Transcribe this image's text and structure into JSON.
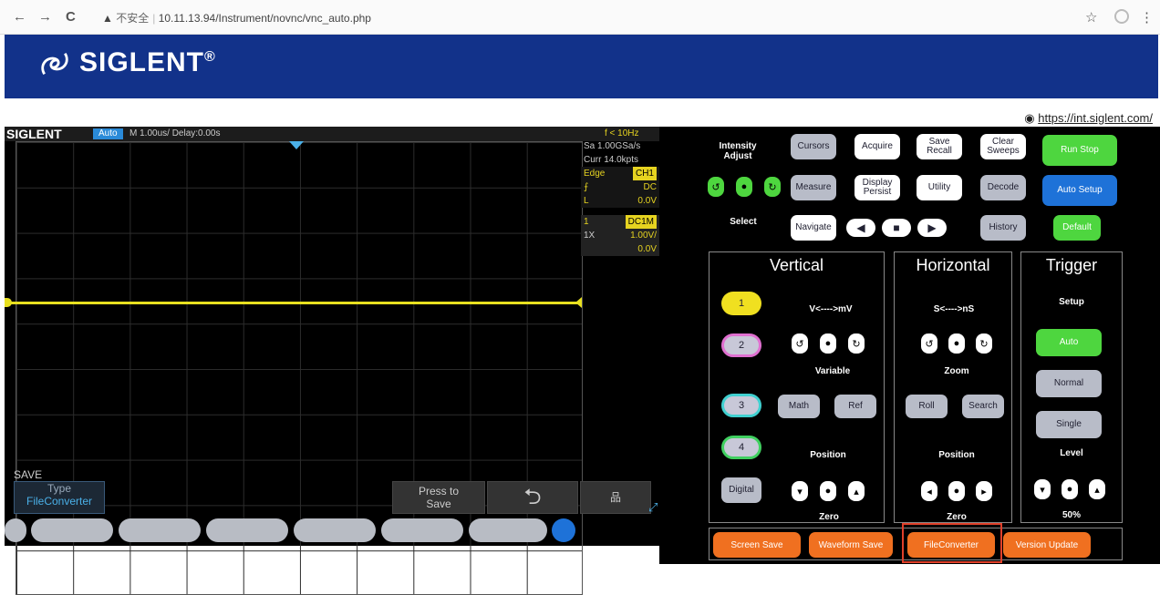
{
  "browser": {
    "security": "不安全",
    "url": "10.11.13.94/Instrument/novnc/vnc_auto.php",
    "back": "←",
    "forward": "→",
    "reload": "C",
    "star": "☆",
    "menu": "⋮"
  },
  "header": {
    "brand": "SIGLENT",
    "reg": "®"
  },
  "link": {
    "text": "https://int.siglent.com/"
  },
  "scope": {
    "brand": "SIGLENT",
    "mode": "Auto",
    "timebase": "M 1.00us/  Delay:0.00s",
    "freq": "f < 10Hz",
    "sa": "Sa 1.00GSa/s",
    "curr": "Curr 14.0kpts",
    "edge": "Edge",
    "edge_ch": "CH1",
    "slope": "⨍",
    "coupling": "DC",
    "level_l": "L",
    "level_v": "0.0V",
    "ch_num": "1",
    "ch_cpl": "DC1M",
    "probe": "1X",
    "vdiv": "1.00V/",
    "offset": "0.0V",
    "save_title": "SAVE",
    "type_label": "Type",
    "type_value": "FileConverter",
    "press_save_1": "Press to",
    "press_save_2": "Save",
    "return_icon": "⮌",
    "net_icon": "品",
    "expand_icon": "⤢"
  },
  "panel": {
    "intensity": "Intensity\nAdjust",
    "select": "Select",
    "cursors": "Cursors",
    "acquire": "Acquire",
    "save_recall": "Save Recall",
    "clear_sweeps": "Clear Sweeps",
    "run_stop": "Run Stop",
    "measure": "Measure",
    "display_persist": "Display Persist",
    "utility": "Utility",
    "decode": "Decode",
    "auto_setup": "Auto Setup",
    "navigate": "Navigate",
    "history": "History",
    "default": "Default",
    "vertical": "Vertical",
    "horizontal": "Horizontal",
    "trigger": "Trigger",
    "v_scale": "V<---->mV",
    "h_scale": "S<---->nS",
    "setup": "Setup",
    "ch1": "1",
    "ch2": "2",
    "ch3": "3",
    "ch4": "4",
    "digital": "Digital",
    "variable": "Variable",
    "zoom": "Zoom",
    "math": "Math",
    "ref": "Ref",
    "roll": "Roll",
    "search": "Search",
    "auto": "Auto",
    "normal": "Normal",
    "single": "Single",
    "level": "Level",
    "position_v": "Position",
    "position_h": "Position",
    "zero_v": "Zero",
    "zero_h": "Zero",
    "fifty": "50%",
    "screen_save": "Screen Save",
    "waveform_save": "Waveform Save",
    "file_converter": "FileConverter",
    "version_update": "Version Update"
  },
  "colors": {
    "header": "#12328a",
    "trace": "#e8e020",
    "green": "#4ed63f",
    "blue": "#1e72d8",
    "orange": "#f07020",
    "highlight": "#e0402a"
  }
}
